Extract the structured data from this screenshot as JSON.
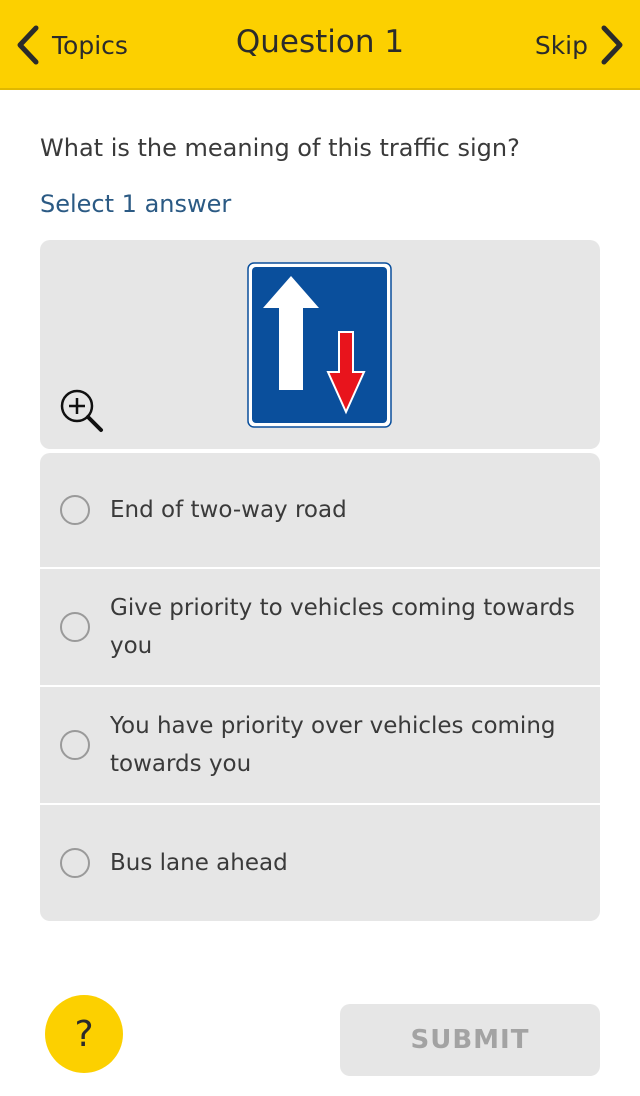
{
  "header": {
    "back_label": "Topics",
    "title": "Question 1",
    "skip_label": "Skip",
    "background_color": "#fcd000"
  },
  "question": {
    "text": "What is the meaning of this traffic sign?",
    "instruction": "Select 1 answer",
    "instruction_color": "#2b5a84"
  },
  "image": {
    "sign_icon": "priority-over-oncoming-traffic-sign",
    "sign_colors": {
      "background": "#0a4f9c",
      "major_arrow": "#ffffff",
      "minor_arrow": "#e8141c"
    },
    "zoom_icon": "zoom-in-icon"
  },
  "answers": [
    {
      "label": "End of two-way road",
      "selected": false
    },
    {
      "label": "Give priority to vehicles coming towards you",
      "selected": false
    },
    {
      "label": "You have priority over vehicles coming towards you",
      "selected": false
    },
    {
      "label": "Bus lane ahead",
      "selected": false
    }
  ],
  "footer": {
    "help_label": "?",
    "submit_label": "SUBMIT",
    "submit_enabled": false
  }
}
